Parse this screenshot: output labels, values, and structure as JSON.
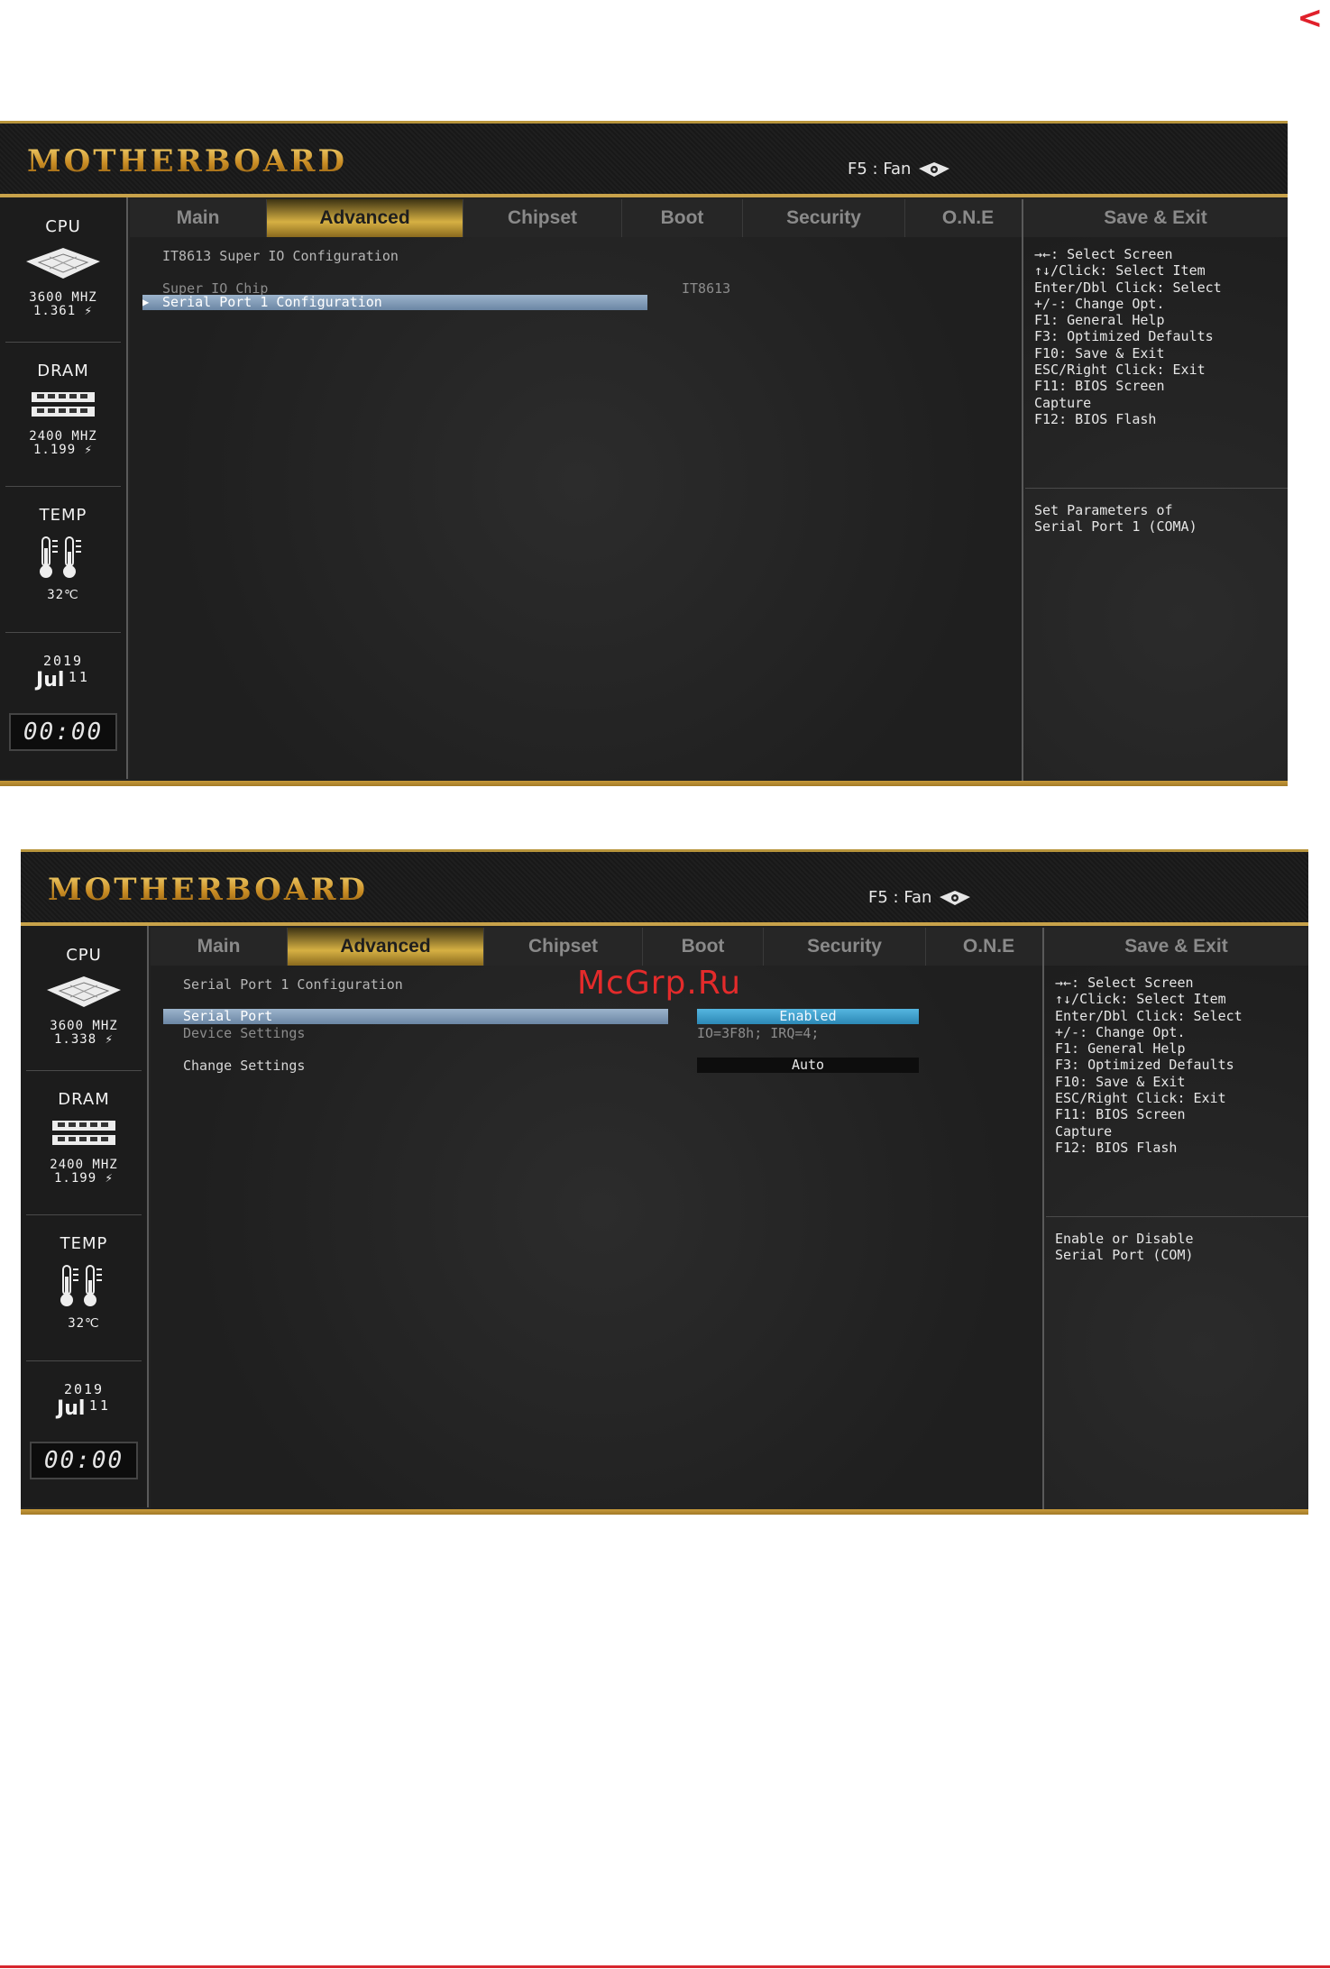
{
  "page": {
    "corner_mark": "<",
    "watermark": "McGrp.Ru"
  },
  "screens": [
    {
      "brand": "MOTHERBOARD",
      "fan_label": "F5 : Fan",
      "fan_icon": "fan-icon",
      "cpu": {
        "label": "CPU",
        "freq": "3600 MHZ",
        "volt": "1.361 ⚡"
      },
      "dram": {
        "label": "DRAM",
        "freq": "2400 MHZ",
        "volt": "1.199 ⚡"
      },
      "temp": {
        "label": "TEMP",
        "value": "32℃"
      },
      "date": {
        "year": "2019",
        "month": "Jul",
        "day": "11"
      },
      "clock": "00:00",
      "tabs": [
        "Main",
        "Advanced",
        "Chipset",
        "Boot",
        "Security",
        "O.N.E"
      ],
      "active_tab": "Advanced",
      "save_exit": "Save & Exit",
      "heading": "IT8613 Super IO Configuration",
      "rows": [
        {
          "label": "Super IO Chip",
          "value": "IT8613"
        },
        {
          "label": "Serial Port 1 Configuration"
        }
      ],
      "help": "→←: Select Screen\n↑↓/Click: Select Item\nEnter/Dbl Click: Select\n+/-: Change Opt.\nF1: General Help\nF3: Optimized Defaults\nF10: Save & Exit\nESC/Right Click: Exit\nF11: BIOS Screen\nCapture\nF12: BIOS Flash",
      "description": "Set Parameters of\nSerial Port 1 (COMA)"
    },
    {
      "brand": "MOTHERBOARD",
      "fan_label": "F5 : Fan",
      "fan_icon": "fan-icon",
      "cpu": {
        "label": "CPU",
        "freq": "3600 MHZ",
        "volt": "1.338 ⚡"
      },
      "dram": {
        "label": "DRAM",
        "freq": "2400 MHZ",
        "volt": "1.199 ⚡"
      },
      "temp": {
        "label": "TEMP",
        "value": "32℃"
      },
      "date": {
        "year": "2019",
        "month": "Jul",
        "day": "11"
      },
      "clock": "00:00",
      "tabs": [
        "Main",
        "Advanced",
        "Chipset",
        "Boot",
        "Security",
        "O.N.E"
      ],
      "active_tab": "Advanced",
      "save_exit": "Save & Exit",
      "heading": "Serial Port 1 Configuration",
      "rows": [
        {
          "label": "Serial Port",
          "value": "Enabled"
        },
        {
          "label": "Device Settings",
          "value": "IO=3F8h; IRQ=4;"
        },
        {
          "label": "Change Settings",
          "value": "Auto"
        }
      ],
      "help": "→←: Select Screen\n↑↓/Click: Select Item\nEnter/Dbl Click: Select\n+/-: Change Opt.\nF1: General Help\nF3: Optimized Defaults\nF10: Save & Exit\nESC/Right Click: Exit\nF11: BIOS Screen\nCapture\nF12: BIOS Flash",
      "description": "Enable or Disable\nSerial Port (COM)"
    }
  ]
}
